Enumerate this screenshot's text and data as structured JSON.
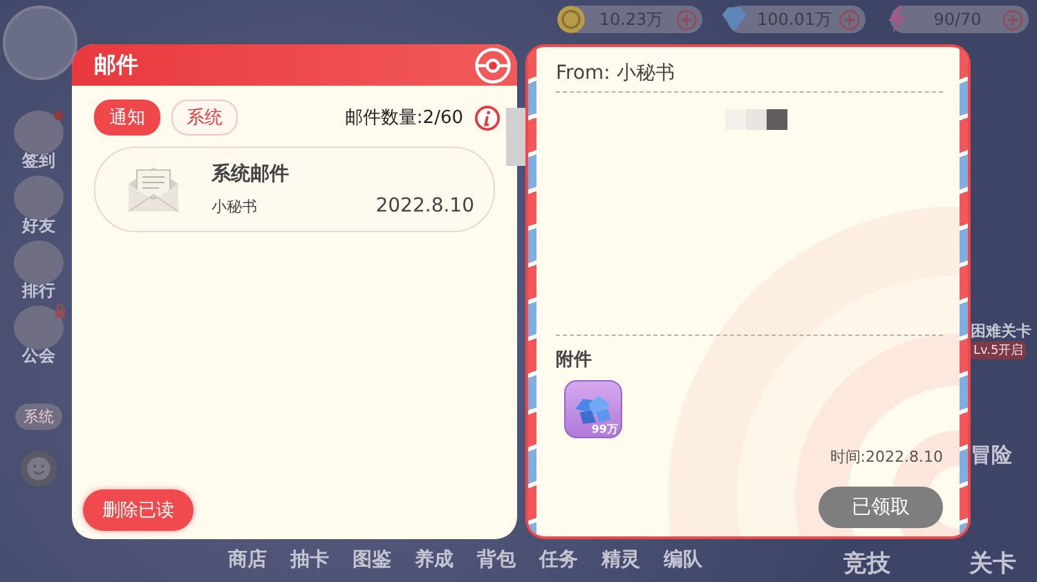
{
  "top_bar": {
    "resources": [
      {
        "kind": "coin",
        "amount": "10.23万"
      },
      {
        "kind": "diamond",
        "amount": "100.01万"
      },
      {
        "kind": "energy",
        "amount": "90/70"
      }
    ]
  },
  "side_menu": [
    {
      "kind": "icon",
      "label": "签到",
      "notification": true,
      "locked": false
    },
    {
      "kind": "icon",
      "label": "好友",
      "notification": false,
      "locked": false
    },
    {
      "kind": "icon",
      "label": "排行",
      "notification": false,
      "locked": false
    },
    {
      "kind": "icon",
      "label": "公会",
      "notification": false,
      "locked": true
    },
    {
      "kind": "pill",
      "label": "系统",
      "notification": false,
      "locked": false
    }
  ],
  "right_menu": [
    {
      "label": "困难关卡",
      "sub": "Lv.5开启"
    },
    {
      "label": "冒险"
    }
  ],
  "bottom_nav": [
    "商店",
    "抽卡",
    "图鉴",
    "养成",
    "背包",
    "任务",
    "精灵",
    "编队",
    "竞技",
    "关卡"
  ],
  "mail_panel": {
    "title": "邮件",
    "tabs": [
      {
        "label": "通知",
        "selected": true
      },
      {
        "label": "系统",
        "selected": false
      }
    ],
    "count": "邮件数量:2/60",
    "mails": [
      {
        "title": "系统邮件",
        "sender": "小秘书",
        "date": "2022.8.10"
      }
    ],
    "delete_button": "删除已读"
  },
  "letter": {
    "from": "From: 小秘书",
    "attachments_heading": "附件",
    "attachments": [
      {
        "amount": "99万"
      }
    ],
    "time": "时间:2022.8.10",
    "claim_button": "已领取",
    "claimed": true
  }
}
